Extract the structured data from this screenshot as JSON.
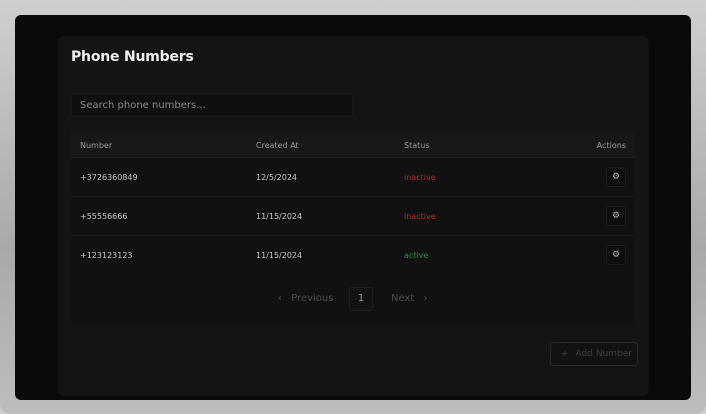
{
  "page": {
    "title": "Phone Numbers"
  },
  "search": {
    "placeholder": "Search phone numbers..."
  },
  "table": {
    "headers": {
      "number": "Number",
      "created_at": "Created At",
      "status": "Status",
      "actions": "Actions"
    },
    "rows": [
      {
        "number": "+3726360849",
        "created_at": "12/5/2024",
        "status": "inactive"
      },
      {
        "number": "+55556666",
        "created_at": "11/15/2024",
        "status": "inactive"
      },
      {
        "number": "+123123123",
        "created_at": "11/15/2024",
        "status": "active"
      }
    ],
    "action_icon": "gear-icon"
  },
  "pagination": {
    "previous_label": "Previous",
    "page": "1",
    "next_label": "Next"
  },
  "add_button": {
    "label": "Add Number"
  },
  "colors": {
    "inactive": "#b02a2a",
    "active": "#2f8a4b",
    "background": "#0a0a0a",
    "card": "#141414"
  }
}
